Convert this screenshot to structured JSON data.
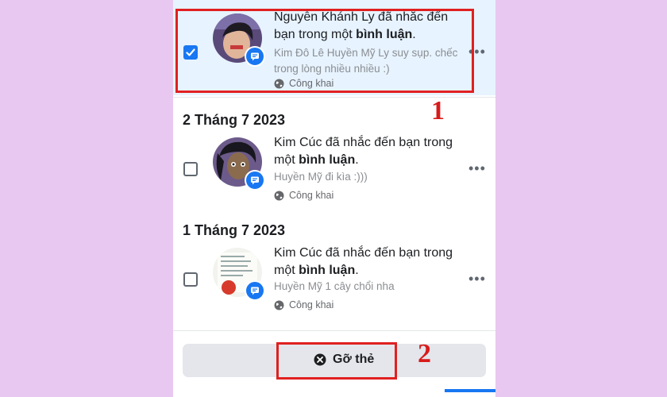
{
  "notifications": [
    {
      "title_prefix": "Nguyễn Khánh Ly đã nhắc đến bạn trong một ",
      "title_bold": "bình luận",
      "title_suffix": ".",
      "preview": "Kim Đô Lê Huyền Mỹ Ly suy sụp. chếc trong lòng nhiều nhiều :)",
      "privacy": "Công khai",
      "checked": true
    },
    {
      "title_prefix": "Kim Cúc đã nhắc đến bạn trong một ",
      "title_bold": "bình luận",
      "title_suffix": ".",
      "preview": "Huyền Mỹ đi kìa :)))",
      "privacy": "Công khai",
      "checked": false
    },
    {
      "title_prefix": "Kim Cúc đã nhắc đến bạn trong một ",
      "title_bold": "bình luận",
      "title_suffix": ".",
      "preview": "Huyền Mỹ 1 cây chổi nha",
      "privacy": "Công khai",
      "checked": false
    }
  ],
  "date_headers": [
    "2 Tháng 7 2023",
    "1 Tháng 7 2023"
  ],
  "more_label": "•••",
  "remove_button": {
    "label": "Gỡ thẻ",
    "icon": "close-circle-icon"
  },
  "annotations": [
    "1",
    "2"
  ],
  "colors": {
    "accent": "#1877f2",
    "selected_bg": "#e7f3ff",
    "annotation": "#e02020",
    "background": "#e8c8f0"
  }
}
